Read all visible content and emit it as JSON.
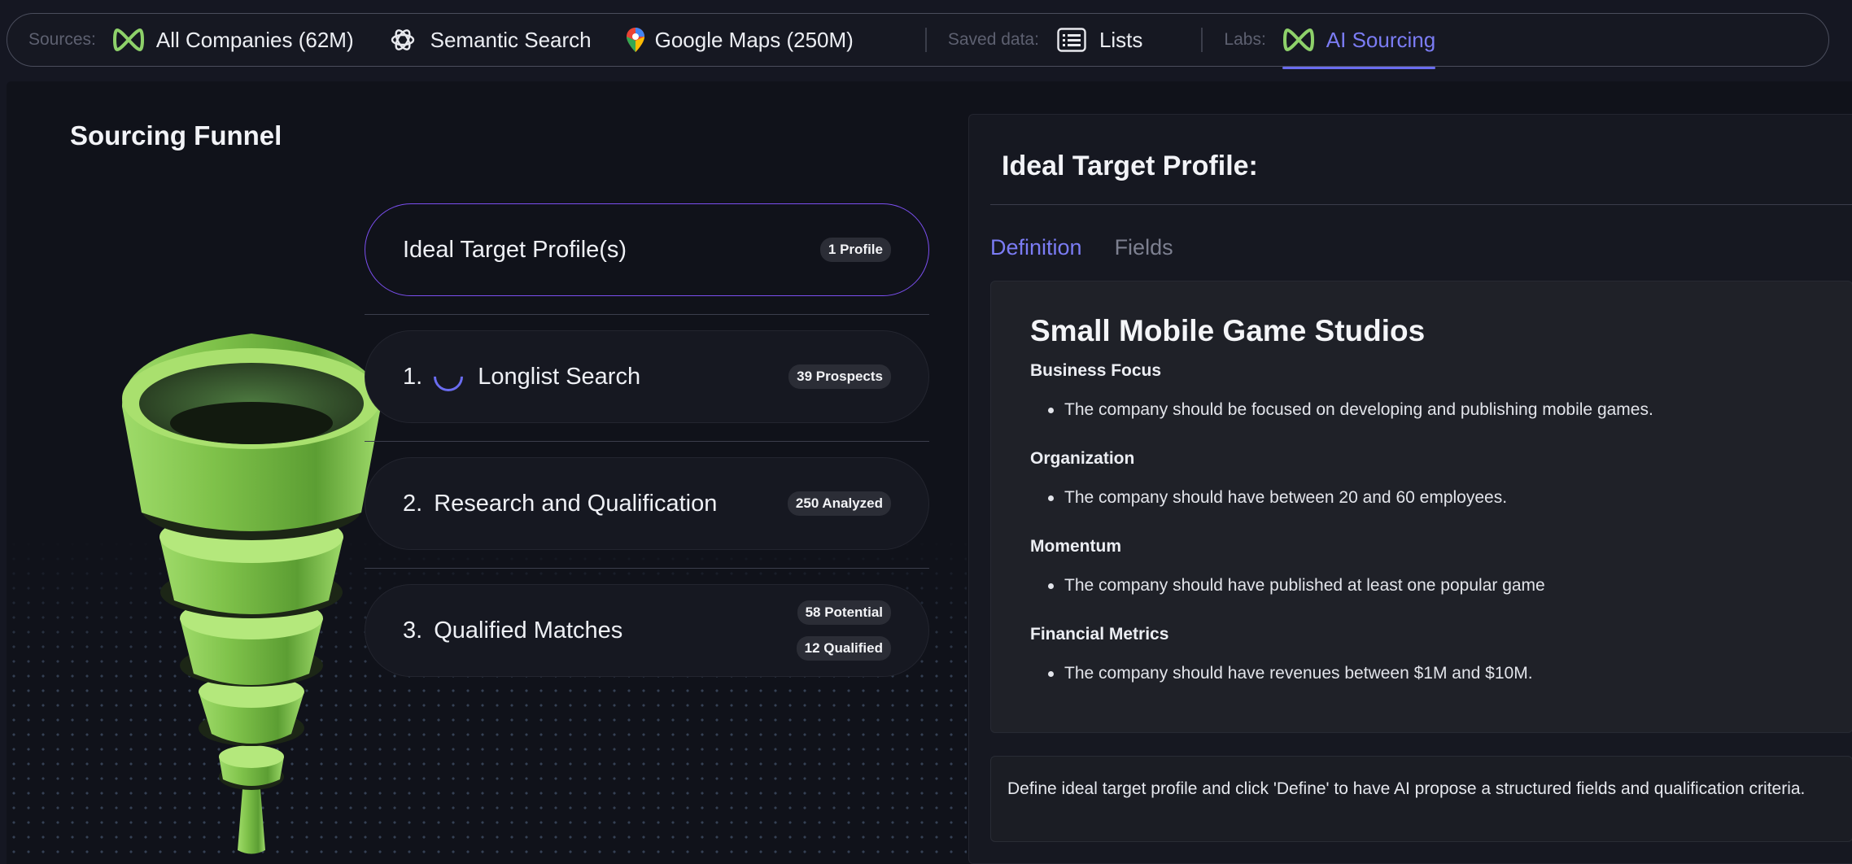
{
  "nav": {
    "sources_label": "Sources:",
    "all_companies": "All Companies (62M)",
    "semantic_search": "Semantic Search",
    "google_maps": "Google Maps (250M)",
    "saved_label": "Saved data:",
    "lists": "Lists",
    "labs_label": "Labs:",
    "ai_sourcing": "AI Sourcing",
    "active_item": "AI Sourcing",
    "accent_color": "#7b7cf4",
    "brand_color": "#8ed16a"
  },
  "funnel": {
    "title": "Sourcing Funnel",
    "stages": [
      {
        "label": "Ideal Target Profile(s)",
        "badges": [
          "1 Profile"
        ]
      },
      {
        "number": "1.",
        "label": "Longlist Search",
        "badges": [
          "39 Prospects"
        ],
        "status": "loading"
      },
      {
        "number": "2.",
        "label": "Research and Qualification",
        "badges": [
          "250 Analyzed"
        ]
      },
      {
        "number": "3.",
        "label": "Qualified Matches",
        "badges": [
          "58 Potential",
          "12 Qualified"
        ]
      }
    ]
  },
  "profile": {
    "title": "Ideal Target Profile:",
    "tabs": [
      "Definition",
      "Fields"
    ],
    "active_tab": "Definition",
    "heading": "Small Mobile Game Studios",
    "sections": [
      {
        "title": "Business Focus",
        "item": "The company should be focused on developing and publishing mobile games."
      },
      {
        "title": "Organization",
        "item": "The company should have between 20 and 60 employees."
      },
      {
        "title": "Momentum",
        "item": "The company should have published at least one popular game"
      },
      {
        "title": "Financial Metrics",
        "item": "The company should have revenues between $1M and $10M."
      }
    ],
    "hint": "Define ideal target profile and click 'Define' to have AI propose a structured fields and qualification criteria."
  }
}
